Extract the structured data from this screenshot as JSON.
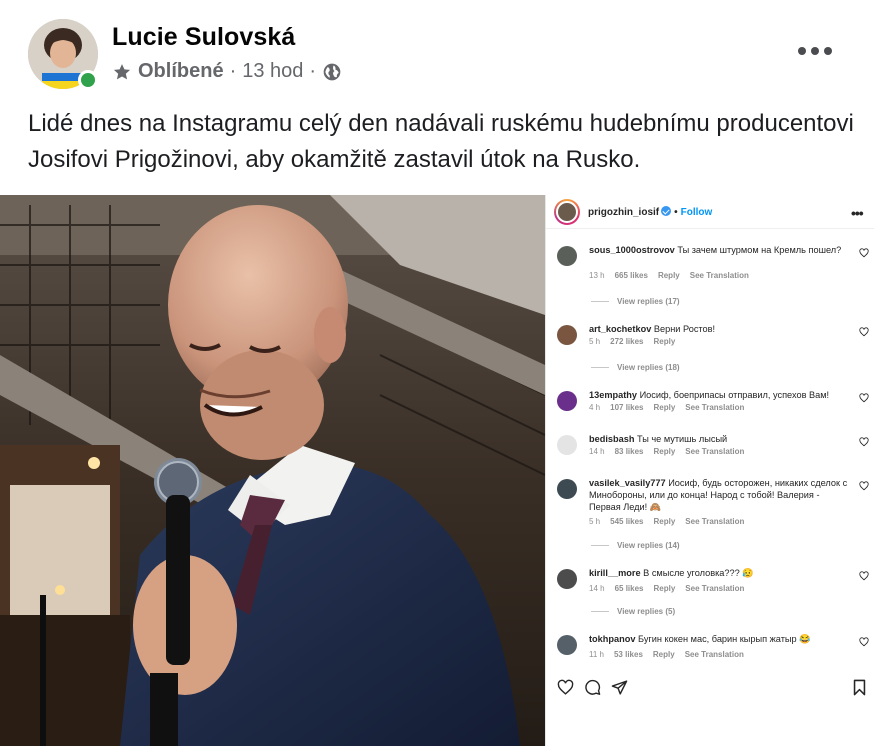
{
  "post": {
    "author": "Lucie Sulovská",
    "audience_label": "Oblíbené",
    "separator": "·",
    "time": "13 hod",
    "text": "Lidé dnes na Instagramu celý den nadávali ruskému hudebnímu producentovi Josifovi Prigožinovi, aby okamžitě zastavil útok na Rusko.",
    "icons": {
      "audience": "star-icon",
      "privacy": "globe-icon",
      "more": "more-dots-icon"
    }
  },
  "instagram": {
    "username": "prigozhin_iosif",
    "dot": "•",
    "follow_label": "Follow",
    "more_label": "•••",
    "comments": [
      {
        "user": "sous_1000ostrovov",
        "text": "Ты зачем штурмом на Кремль пошел?",
        "time": "13 h",
        "likes": "665 likes",
        "reply": "Reply",
        "translate": "See Translation",
        "replies": "View replies (17)"
      },
      {
        "user": "art_kochetkov",
        "text": "Верни Ростов!",
        "time": "5 h",
        "likes": "272 likes",
        "reply": "Reply",
        "translate": "",
        "replies": "View replies (18)"
      },
      {
        "user": "13empathy",
        "text": "Иосиф, боеприпасы отправил, успехов Вам!",
        "time": "4 h",
        "likes": "107 likes",
        "reply": "Reply",
        "translate": "See Translation",
        "replies": ""
      },
      {
        "user": "bedisbash",
        "text": "Ты че мутишь лысый",
        "time": "14 h",
        "likes": "83 likes",
        "reply": "Reply",
        "translate": "See Translation",
        "replies": ""
      },
      {
        "user": "vasilek_vasily777",
        "text": "Иосиф, будь осторожен, никаких сделок с Минобороны, или до конца! Народ с тобой! Валерия - Первая Леди! 🙈",
        "time": "5 h",
        "likes": "545 likes",
        "reply": "Reply",
        "translate": "See Translation",
        "replies": "View replies (14)"
      },
      {
        "user": "kirill__more",
        "text": "В смысле уголовка??? 😥",
        "time": "14 h",
        "likes": "65 likes",
        "reply": "Reply",
        "translate": "See Translation",
        "replies": "View replies (5)"
      },
      {
        "user": "tokhpanov",
        "text": "Бугин кокен мас, барин кырып жатыр 😂",
        "time": "11 h",
        "likes": "53 likes",
        "reply": "Reply",
        "translate": "See Translation",
        "replies": ""
      }
    ],
    "action_icons": [
      "heart-icon",
      "comment-icon",
      "share-icon",
      "bookmark-icon"
    ]
  },
  "colors": {
    "online": "#31a24c",
    "meta_gray": "#65676b",
    "ig_blue": "#0095f6",
    "ig_gray": "#8e8e8e"
  }
}
